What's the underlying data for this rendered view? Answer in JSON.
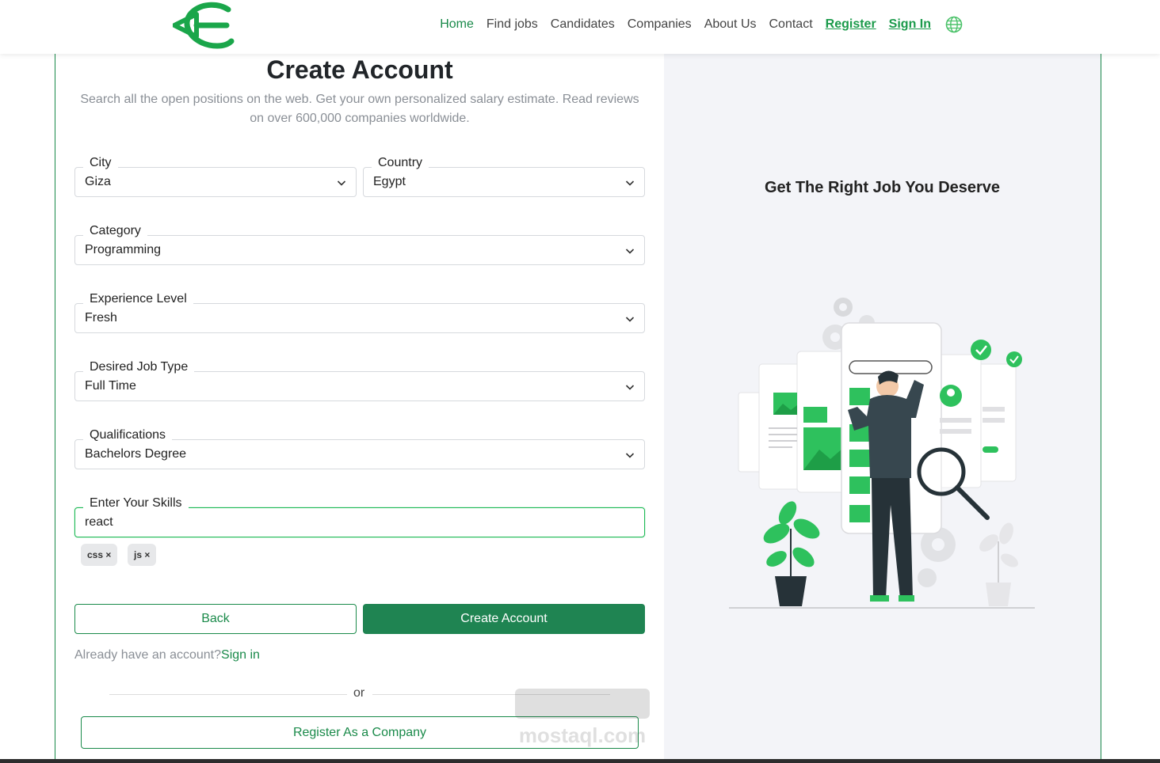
{
  "nav": {
    "items": [
      "Home",
      "Find jobs",
      "Candidates",
      "Companies",
      "About Us",
      "Contact"
    ],
    "register": "Register",
    "sign_in": "Sign In"
  },
  "colors": {
    "brand": "#1a8a4a",
    "accent": "#1db954",
    "button": "#1f8452",
    "panel_bg": "#f3f4f8"
  },
  "form": {
    "title": "Create Account",
    "subtitle": "Search all the open positions on the web. Get your own personalized salary estimate. Read reviews on over 600,000 companies worldwide.",
    "city": {
      "label": "City",
      "value": "Giza"
    },
    "country": {
      "label": "Country",
      "value": "Egypt"
    },
    "category": {
      "label": "Category",
      "value": "Programming"
    },
    "experience": {
      "label": "Experience Level",
      "value": "Fresh"
    },
    "job_type": {
      "label": "Desired Job Type",
      "value": "Full Time"
    },
    "qualifications": {
      "label": "Qualifications",
      "value": "Bachelors Degree"
    },
    "skills": {
      "label": "Enter Your Skills",
      "value": "react",
      "tags": [
        "css ×",
        "js ×"
      ]
    },
    "back_label": "Back",
    "create_label": "Create Account",
    "already_text": "Already have an account?",
    "sign_in_link": "Sign in",
    "or_text": "or",
    "company_label": "Register As a Company"
  },
  "panel": {
    "heading": "Get The Right Job You Deserve"
  },
  "icons": [
    "logo-icon",
    "globe-icon",
    "chevron-down-icon",
    "watermark-logo"
  ],
  "watermark": {
    "text": "mostaql.com"
  }
}
